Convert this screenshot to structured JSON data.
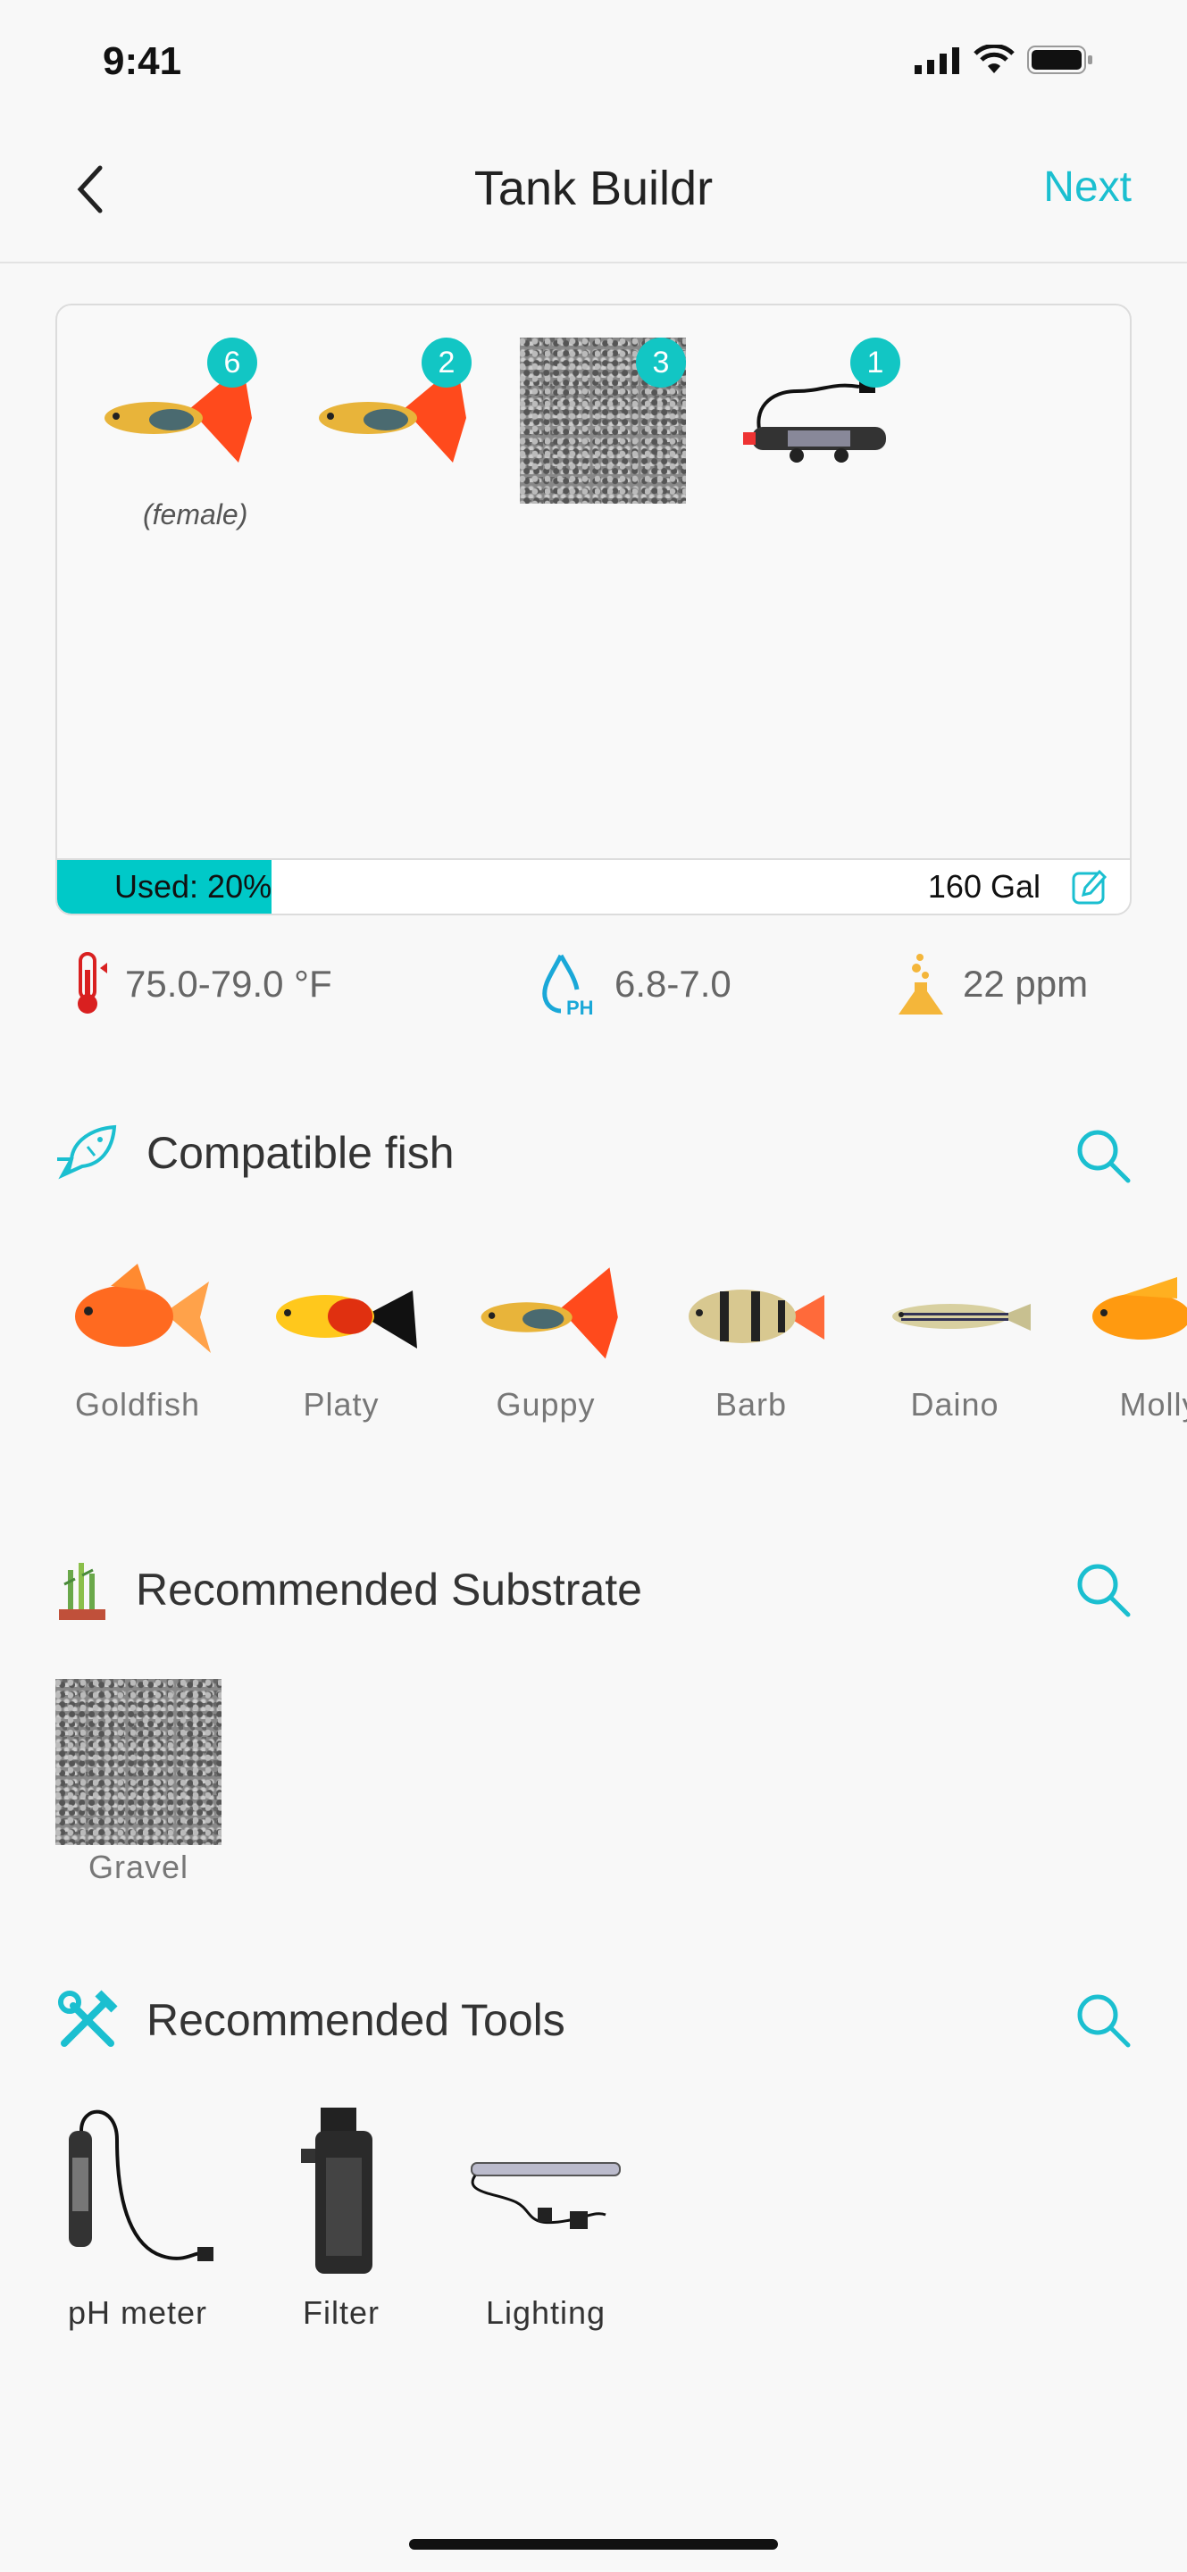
{
  "status_bar": {
    "time": "9:41"
  },
  "header": {
    "title": "Tank Buildr",
    "next_label": "Next"
  },
  "tank": {
    "items": [
      {
        "name": "Guppy",
        "count": "6",
        "note": "(female)"
      },
      {
        "name": "Guppy",
        "count": "2"
      },
      {
        "name": "Gravel",
        "count": "3"
      },
      {
        "name": "Heater",
        "count": "1"
      }
    ],
    "used_label": "Used:",
    "used_value": "20%",
    "used_percent": 20,
    "volume": "160 Gal"
  },
  "stats": {
    "temperature": "75.0-79.0 °F",
    "ph": "6.8-7.0",
    "hardness": "22 ppm"
  },
  "compatible_fish": {
    "title": "Compatible fish",
    "items": [
      "Goldfish",
      "Platy",
      "Guppy",
      "Barb",
      "Daino",
      "Molly"
    ]
  },
  "substrate": {
    "title": "Recommended Substrate",
    "items": [
      "Gravel"
    ]
  },
  "tools": {
    "title": "Recommended Tools",
    "items": [
      "pH meter",
      "Filter",
      "Lighting"
    ]
  },
  "colors": {
    "accent": "#1bbfd0",
    "badge": "#12c6c4",
    "used_fill": "#00c9c8"
  }
}
